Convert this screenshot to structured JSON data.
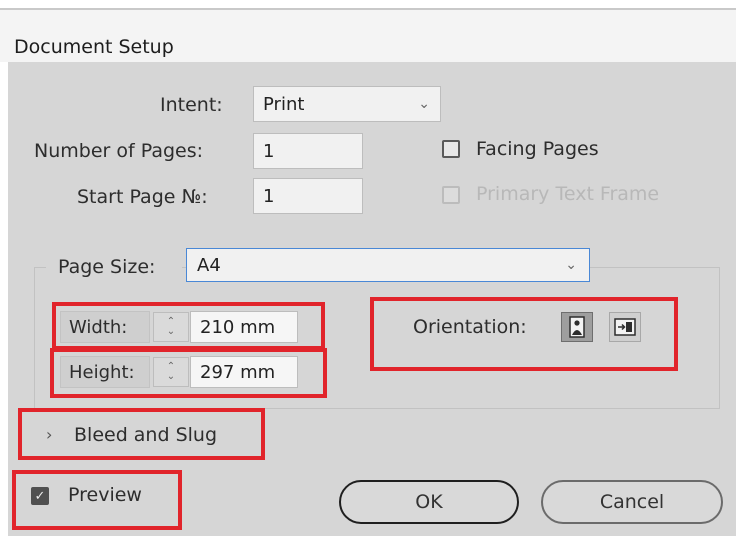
{
  "dialog": {
    "title": "Document Setup"
  },
  "intent": {
    "label": "Intent:",
    "value": "Print"
  },
  "pages": {
    "label": "Number of Pages:",
    "value": "1"
  },
  "start_page": {
    "label": "Start Page №:",
    "value": "1"
  },
  "facing_pages": {
    "label": "Facing Pages",
    "checked": false
  },
  "primary_text_frame": {
    "label": "Primary Text Frame",
    "checked": false,
    "disabled": true
  },
  "page_size": {
    "label": "Page Size:",
    "value": "A4"
  },
  "width": {
    "label": "Width:",
    "value": "210 mm"
  },
  "height": {
    "label": "Height:",
    "value": "297 mm"
  },
  "orientation": {
    "label": "Orientation:",
    "selected": "portrait"
  },
  "bleed": {
    "label": "Bleed and Slug",
    "chevron": "›"
  },
  "preview": {
    "label": "Preview",
    "checked": true
  },
  "buttons": {
    "ok": "OK",
    "cancel": "Cancel"
  },
  "colors": {
    "highlight": "#e1242b",
    "focus_border": "#4a88d6",
    "dialog_bg": "#d6d6d6"
  }
}
